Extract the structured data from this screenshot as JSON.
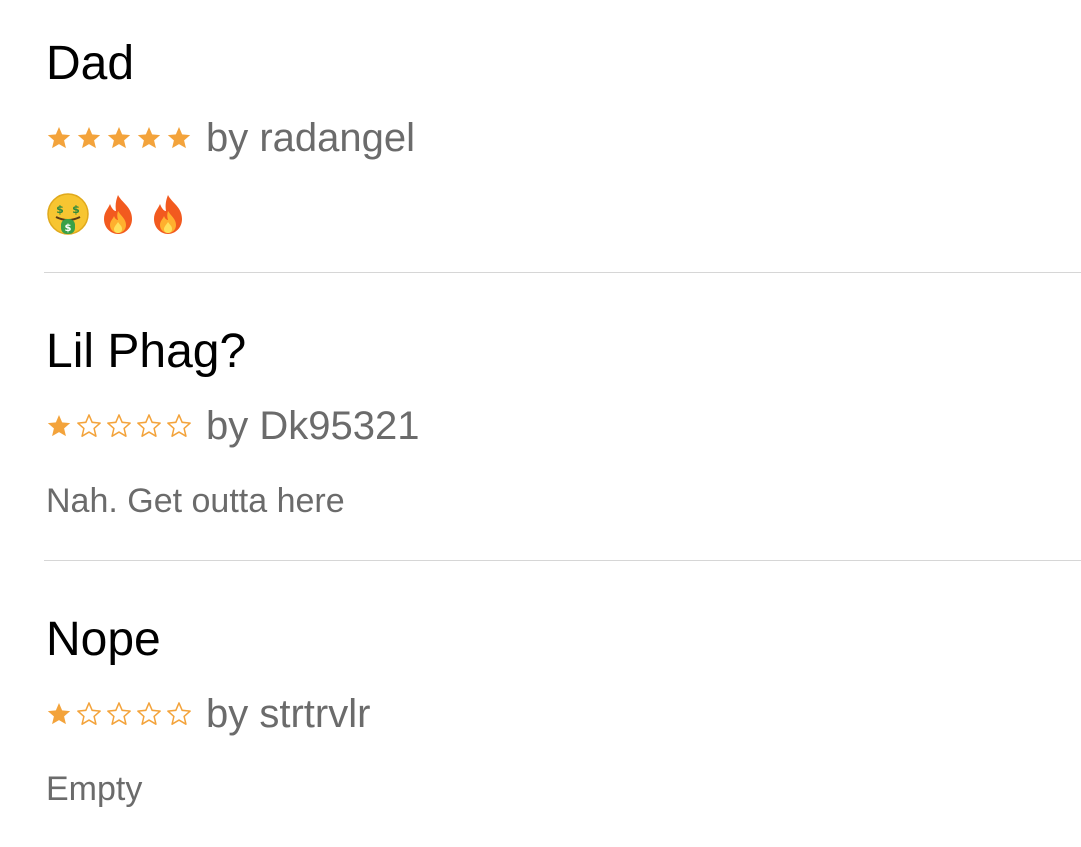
{
  "reviews": [
    {
      "title": "Dad",
      "rating": 5,
      "max_rating": 5,
      "author": "by radangel",
      "body_icons": [
        "money-mouth-face-icon",
        "fire-icon",
        "fire-icon"
      ]
    },
    {
      "title": "Lil Phag?",
      "rating": 1,
      "max_rating": 5,
      "author": "by Dk95321",
      "body": "Nah. Get outta here"
    },
    {
      "title": "Nope",
      "rating": 1,
      "max_rating": 5,
      "author": "by strtrvlr",
      "body": "Empty"
    }
  ],
  "colors": {
    "star": "#f3a33b",
    "title": "#000000",
    "secondary_text": "#6b6b6b",
    "divider": "#d6d6d6"
  }
}
